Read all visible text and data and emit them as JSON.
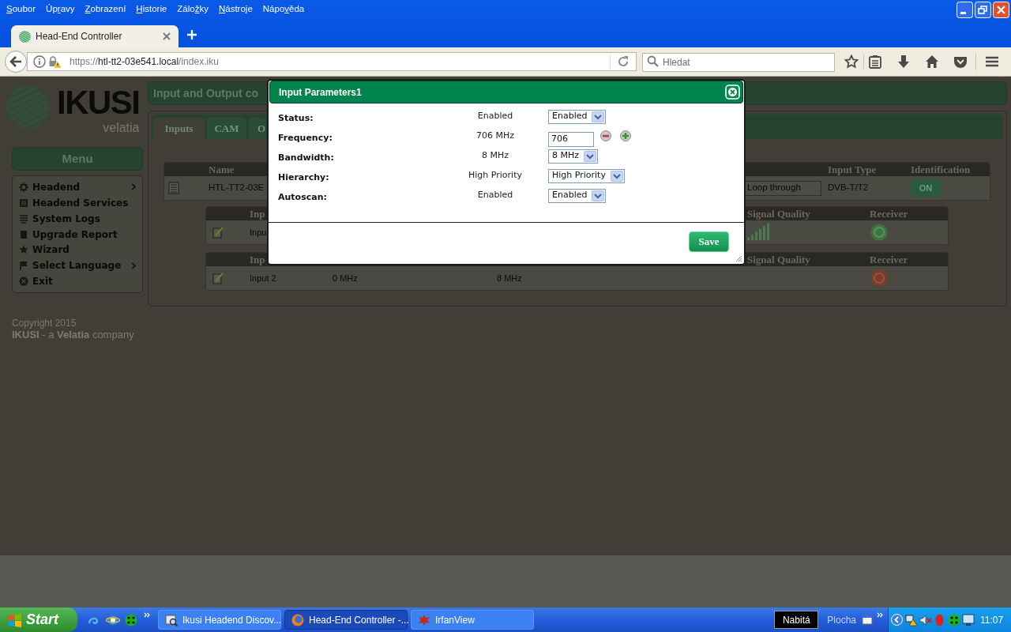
{
  "menu_bar": [
    {
      "key": "S",
      "rest": "oubor"
    },
    {
      "lead": "Úp",
      "key": "r",
      "rest": "avy"
    },
    {
      "key": "Z",
      "rest": "obrazení"
    },
    {
      "key": "H",
      "rest": "istorie"
    },
    {
      "lead": "Zálo",
      "key": "ž",
      "rest": "ky"
    },
    {
      "key": "N",
      "rest": "ástroje"
    },
    {
      "lead": "Nápo",
      "key": "v",
      "rest": "ěda"
    }
  ],
  "browser": {
    "tabs": [
      {
        "title": "Head-End Controller",
        "selected": true
      }
    ],
    "url": {
      "scheme": "https://",
      "host": "htl-tt2-03e541.local",
      "path": "/index.iku"
    },
    "search": {
      "placeholder": "Hledat"
    }
  },
  "sidebar": {
    "logo": {
      "name": "IKUSI",
      "tagline": "velatia"
    },
    "menu_title": "Menu",
    "items": [
      {
        "label": "Headend",
        "submenu": true
      },
      {
        "label": "Headend Services",
        "submenu": false
      },
      {
        "label": "System Logs",
        "submenu": false
      },
      {
        "label": "Upgrade Report",
        "submenu": false
      },
      {
        "label": "Wizard",
        "submenu": false
      },
      {
        "label": "Select Language",
        "submenu": true
      },
      {
        "label": "Exit",
        "submenu": false
      }
    ],
    "copyright": "Copyright 2015",
    "company": "**IKUSI** - a **Velatia** company"
  },
  "main": {
    "title": "Input and Output co",
    "tabs": [
      {
        "label": "Inputs",
        "selected": true
      },
      {
        "label": "CAM",
        "selected": false
      },
      {
        "label": "O",
        "selected": false
      }
    ],
    "devices": {
      "columns": {
        "name": "Name",
        "input_type": "Input Type",
        "identification": "Identification"
      },
      "rows": [
        {
          "name": "HTL-TT2-03E",
          "input_mode": "Loop through",
          "input_type": "DVB-T/T2",
          "identification": {
            "label": "ON",
            "on": true
          }
        }
      ]
    },
    "inputs": [
      {
        "columns": {
          "name": "Inp",
          "signal_quality": "Signal Quality",
          "receiver": "Receiver"
        },
        "rows": [
          {
            "name": "Inpu",
            "signal": true,
            "locked": true
          }
        ]
      },
      {
        "columns": {
          "name": "Inp",
          "signal_quality": "Signal Quality",
          "receiver": "Receiver"
        },
        "rows": [
          {
            "name": "Input 2",
            "frequency": "0 MHz",
            "bandwidth": "8 MHz",
            "signal": false,
            "locked": false
          }
        ]
      }
    ]
  },
  "dialog": {
    "title": "Input Parameters1",
    "fields": [
      {
        "label": "Status:",
        "value": "Enabled",
        "control": {
          "kind": "select",
          "value": "Enabled"
        }
      },
      {
        "label": "Frequency:",
        "value": "706 MHz",
        "control": {
          "kind": "stepper",
          "value": "706"
        }
      },
      {
        "label": "Bandwidth:",
        "value": "8 MHz",
        "control": {
          "kind": "select",
          "value": "8 MHz"
        }
      },
      {
        "label": "Hierarchy:",
        "value": "High Priority",
        "control": {
          "kind": "select",
          "value": "High Priority"
        }
      },
      {
        "label": "Autoscan:",
        "value": "Enabled",
        "control": {
          "kind": "select",
          "value": "Enabled"
        }
      }
    ],
    "save": "Save"
  },
  "taskbar": {
    "start": "Start",
    "tasks": [
      {
        "title": "Ikusi Headend Discov...",
        "selected": false
      },
      {
        "title": "Head-End Controller -...",
        "selected": true
      },
      {
        "title": "IrfanView",
        "selected": false
      }
    ],
    "tooltip": "Nabitá",
    "toolbar": "Plocha",
    "clock": "11:07"
  }
}
